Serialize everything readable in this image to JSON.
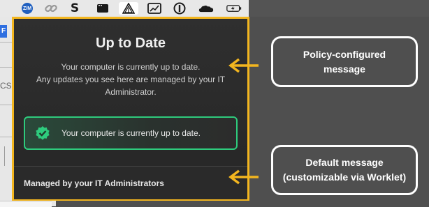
{
  "menubar": {
    "icons": [
      {
        "name": "zm-icon",
        "label": "Z/M"
      },
      {
        "name": "link-icon"
      },
      {
        "name": "s-logo-icon",
        "label": "S"
      },
      {
        "name": "window-icon"
      },
      {
        "name": "warning-tent-icon"
      },
      {
        "name": "chart-window-icon"
      },
      {
        "name": "one-password-icon"
      },
      {
        "name": "cloud-icon"
      },
      {
        "name": "battery-icon"
      }
    ]
  },
  "left_app": {
    "partial_label": "CS",
    "blue_badge": "F"
  },
  "popover": {
    "title": "Up to Date",
    "message_line1": "Your computer is currently up to date.",
    "message_line2": "Any updates you see here are managed by your IT",
    "message_line3": "Administrator.",
    "status_text": "Your computer is currently up to date.",
    "footer_text": "Managed by your IT Administrators"
  },
  "callouts": {
    "policy_line1": "Policy-configured",
    "policy_line2": "message",
    "default_line1": "Default message",
    "default_line2": "(customizable via Worklet)"
  },
  "colors": {
    "highlight": "#f3b61f",
    "success": "#2ecb7d",
    "popover_bg": "#2c2c2c",
    "backdrop": "#4f4f4f"
  }
}
